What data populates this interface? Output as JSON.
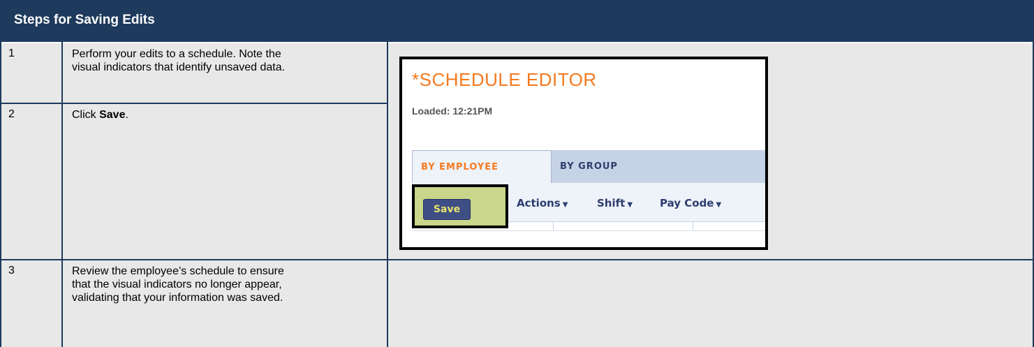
{
  "header": {
    "title": "Steps for Saving Edits"
  },
  "steps": [
    {
      "number": "1",
      "text": "Perform your edits to a schedule. Note the visual indicators that identify unsaved data."
    },
    {
      "number": "2",
      "text_prefix": "Click ",
      "text_bold": "Save",
      "text_suffix": "."
    },
    {
      "number": "3",
      "text": "Review the employee’s schedule to ensure that the visual indicators no longer appear, validating that your information was saved."
    }
  ],
  "screenshot": {
    "title": "*SCHEDULE EDITOR",
    "loaded": "Loaded: 12:21PM",
    "tabs": [
      {
        "label": "BY EMPLOYEE",
        "active": true
      },
      {
        "label": "BY GROUP",
        "active": false
      }
    ],
    "toolbar": {
      "save_label": "Save",
      "actions_label": "Actions",
      "shift_label": "Shift",
      "pay_code_label": "Pay Code",
      "caret_glyph": "▼"
    },
    "colors": {
      "title": "#f47a1f",
      "save_highlight": "#c9d68b",
      "save_button": "#3f4f86",
      "save_text": "#e9e36b"
    }
  },
  "colors": {
    "header_bg": "#1e3a5c",
    "cell_bg": "#e8e8e8"
  }
}
